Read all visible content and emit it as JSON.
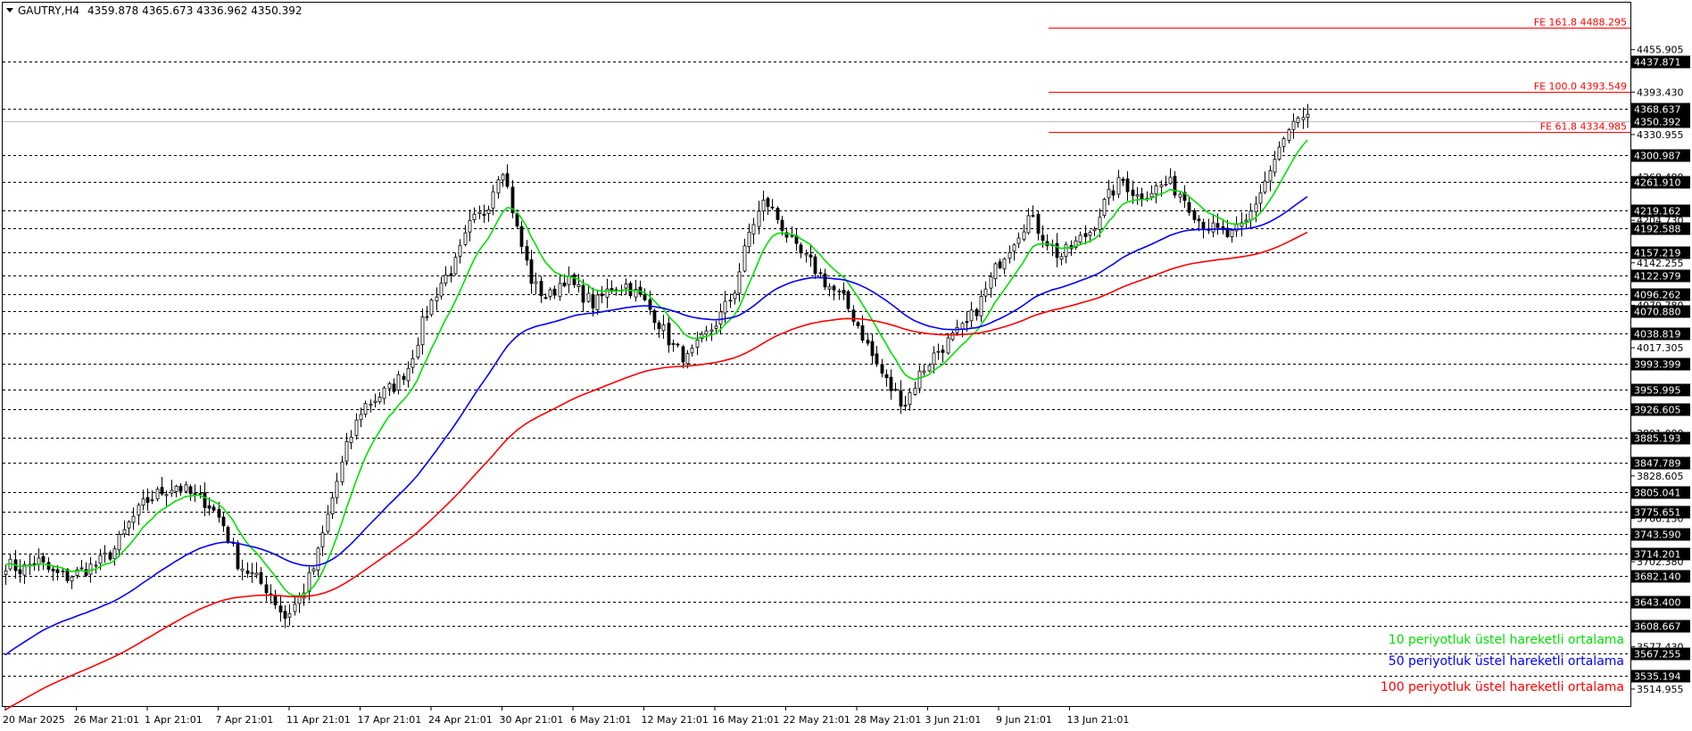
{
  "header": {
    "symbol": "GAUTRY,H4",
    "ohlc": "4359.878 4365.673 4336.962 4350.392"
  },
  "colors": {
    "ema10": "#00e000",
    "ema50": "#0000ff",
    "ema100": "#ff0000",
    "fib": "#ff0000",
    "candle": "#000000",
    "label_bg": "#000000"
  },
  "chart_data": {
    "type": "candlestick",
    "ylim": [
      3490,
      4525
    ],
    "price_ticks": [
      "4455.905",
      "4393.430",
      "4330.955",
      "4268.480",
      "4204.730",
      "4142.255",
      "4079.780",
      "4017.305",
      "3954.830",
      "3891.080",
      "3828.605",
      "3766.130",
      "3702.380",
      "3639.905",
      "3577.430",
      "3514.955"
    ],
    "price_labels": [
      "4437.871",
      "4368.637",
      "4300.987",
      "4261.910",
      "4219.162",
      "4192.588",
      "4157.219",
      "4122.979",
      "4096.262",
      "4070.880",
      "4038.819",
      "3993.399",
      "3955.995",
      "3926.605",
      "3885.193",
      "3847.789",
      "3805.041",
      "3775.651",
      "3743.590",
      "3714.201",
      "3682.140",
      "3643.400",
      "3608.667",
      "3567.255",
      "3535.194"
    ],
    "current_price": "4350.392",
    "fib_levels": [
      {
        "label": "FE 161.8 4488.295",
        "value": 4488.295
      },
      {
        "label": "FE 100.0 4393.549",
        "value": 4393.549
      },
      {
        "label": "FE 61.8 4334.985",
        "value": 4334.985
      }
    ],
    "time_labels": [
      "20 Mar 2025",
      "26 Mar 21:01",
      "1 Apr 21:01",
      "7 Apr 21:01",
      "11 Apr 21:01",
      "17 Apr 21:01",
      "24 Apr 21:01",
      "30 Apr 21:01",
      "6 May 21:01",
      "12 May 21:01",
      "16 May 21:01",
      "22 May 21:01",
      "28 May 21:01",
      "3 Jun 21:01",
      "9 Jun 21:01",
      "13 Jun 21:01"
    ],
    "close_path": [
      3700,
      3690,
      3705,
      3685,
      3680,
      3690,
      3700,
      3720,
      3760,
      3790,
      3805,
      3815,
      3800,
      3790,
      3760,
      3700,
      3680,
      3660,
      3620,
      3650,
      3700,
      3790,
      3870,
      3930,
      3945,
      3960,
      3990,
      4060,
      4110,
      4140,
      4200,
      4220,
      4290,
      4190,
      4110,
      4090,
      4120,
      4100,
      4080,
      4105,
      4110,
      4090,
      4060,
      4020,
      4000,
      4030,
      4060,
      4100,
      4190,
      4235,
      4200,
      4160,
      4140,
      4110,
      4090,
      4050,
      4000,
      3960,
      3935,
      3980,
      4010,
      4030,
      4050,
      4090,
      4140,
      4175,
      4210,
      4180,
      4150,
      4170,
      4190,
      4235,
      4265,
      4240,
      4250,
      4260,
      4240,
      4205,
      4190,
      4180,
      4200,
      4250,
      4300,
      4345,
      4350
    ],
    "series": [
      {
        "name": "10 periyotluk üstel hareketli ortalama",
        "color": "#00e000",
        "period": 10
      },
      {
        "name": "50 periyotluk üstel hareketli ortalama",
        "color": "#0000ff",
        "period": 50
      },
      {
        "name": "100 periyotluk üstel hareketli ortalama",
        "color": "#ff0000",
        "period": 100
      }
    ]
  }
}
